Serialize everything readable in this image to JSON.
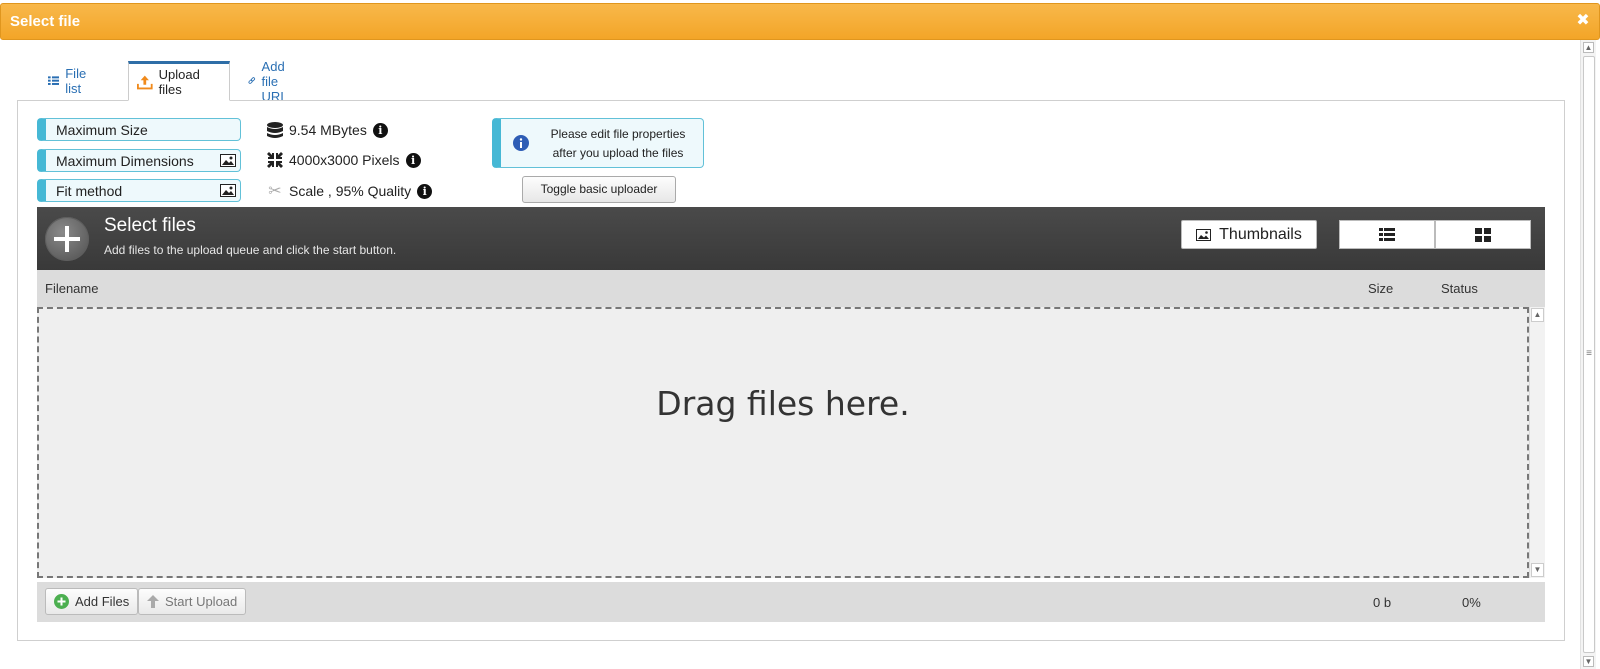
{
  "dialog": {
    "title": "Select file",
    "close_icon": "close-icon"
  },
  "tabs": [
    {
      "label": "File list",
      "icon": "list-icon",
      "active": false
    },
    {
      "label": "Upload files",
      "icon": "upload-icon",
      "active": true
    },
    {
      "label": "Add file URL",
      "icon": "link-icon",
      "active": false
    }
  ],
  "limits": {
    "max_size": {
      "label": "Maximum Size",
      "value": "9.54  MBytes"
    },
    "max_dimensions": {
      "label": "Maximum Dimensions",
      "value": "4000x3000  Pixels"
    },
    "fit_method": {
      "label": "Fit method",
      "value": "Scale , 95% Quality"
    }
  },
  "note": {
    "line1": "Please edit file properties",
    "line2": "after you upload the files"
  },
  "toggle_button": "Toggle basic uploader",
  "uploader": {
    "title": "Select files",
    "subtitle": "Add files to the upload queue and click the start button.",
    "thumbnails_button": "Thumbnails",
    "columns": {
      "filename": "Filename",
      "size": "Size",
      "status": "Status"
    },
    "drop_text": "Drag files here.",
    "add_files": "Add Files",
    "start_upload": "Start Upload",
    "total_size": "0 b",
    "total_percent": "0%"
  },
  "colors": {
    "title_bar": "#f5a92e",
    "accent": "#46b8d5",
    "header_bg": "#404040"
  }
}
